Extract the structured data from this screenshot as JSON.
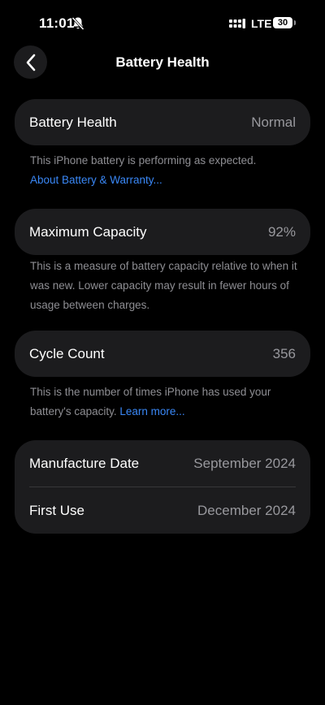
{
  "status_bar": {
    "time": "11:01",
    "network": "LTE",
    "battery_level": "30",
    "icons": [
      "bell-slash-icon",
      "signal-icon",
      "battery-icon"
    ]
  },
  "nav": {
    "title": "Battery Health",
    "back_icon": "chevron-left-icon"
  },
  "sections": {
    "health": {
      "label": "Battery Health",
      "value": "Normal",
      "footnote": "This iPhone battery is performing as expected.",
      "link": "About Battery & Warranty..."
    },
    "capacity": {
      "label": "Maximum Capacity",
      "value": "92%",
      "footnote": "This is a measure of battery capacity relative to when it was new. Lower capacity may result in fewer hours of usage between charges."
    },
    "cycle": {
      "label": "Cycle Count",
      "value": "356",
      "footnote": "This is the number of times iPhone has used your battery's capacity.",
      "link": "Learn more..."
    },
    "dates": {
      "manufacture_label": "Manufacture Date",
      "manufacture_value": "September 2024",
      "first_use_label": "First Use",
      "first_use_value": "December 2024"
    }
  },
  "colors": {
    "background": "#000000",
    "card": "#1c1c1e",
    "secondary_text": "#8e8e93",
    "link": "#3a88f7"
  }
}
